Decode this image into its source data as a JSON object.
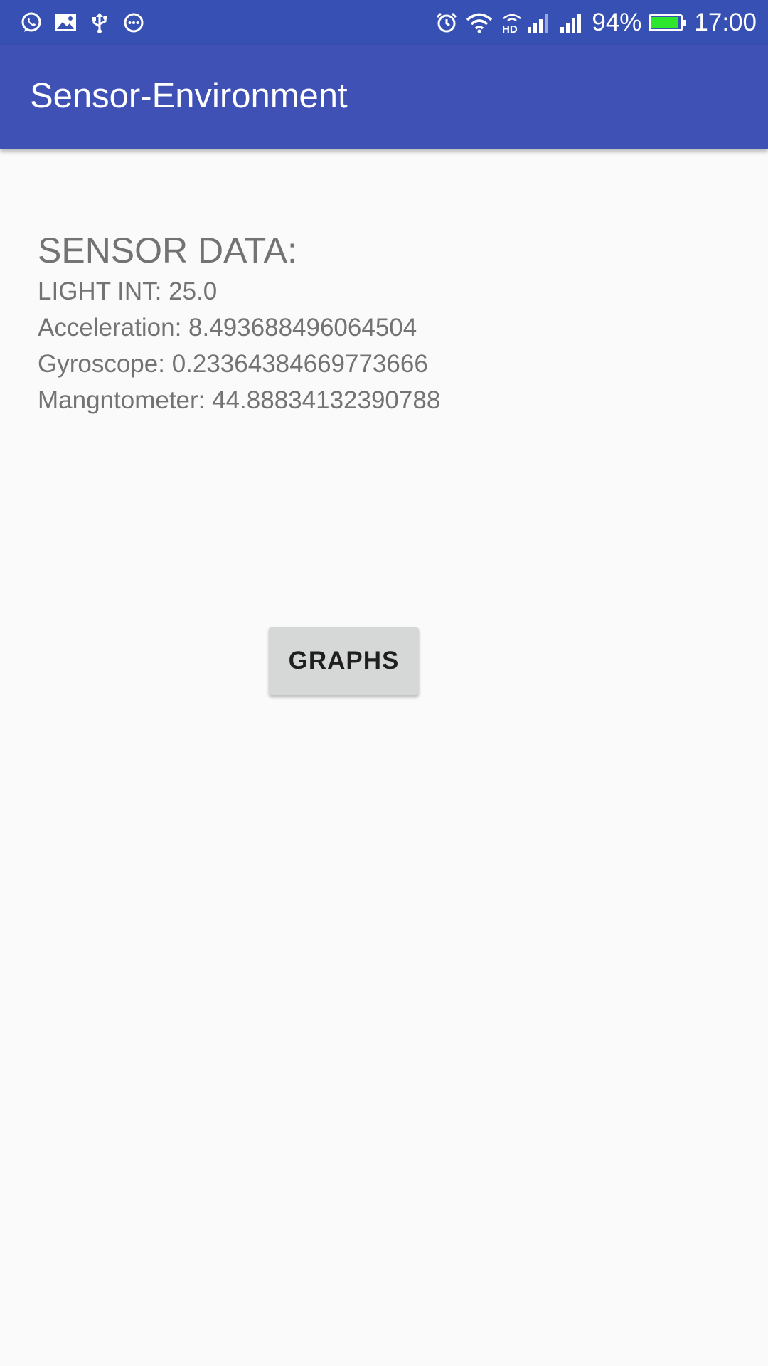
{
  "status_bar": {
    "left_icons": [
      "whatsapp-icon",
      "image-icon",
      "usb-icon",
      "message-icon"
    ],
    "right_icons": [
      "alarm-icon",
      "wifi-icon",
      "hd-signal-icon",
      "signal-icon"
    ],
    "battery_percent_text": "94%",
    "battery_level": 0.94,
    "time": "17:00",
    "battery_color": "#2ee62e",
    "background_color": "#3750b3"
  },
  "app_bar": {
    "title": "Sensor-Environment",
    "background_color": "#3f51b5"
  },
  "sensor": {
    "heading": "SENSOR DATA:",
    "readings": [
      "LIGHT INT: 25.0",
      "Acceleration: 8.493688496064504",
      "Gyroscope: 0.23364384669773666",
      "Mangntometer: 44.88834132390788"
    ]
  },
  "actions": {
    "graphs_label": "GRAPHS"
  }
}
